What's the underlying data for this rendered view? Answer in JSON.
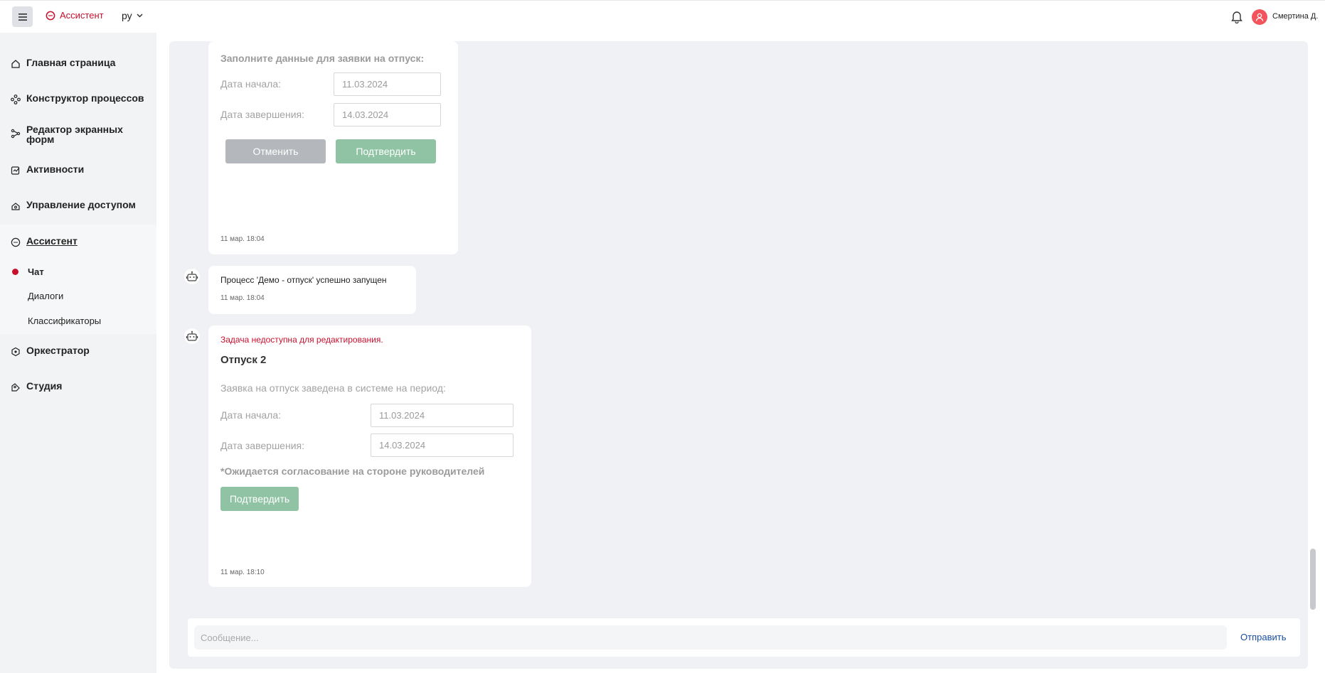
{
  "header": {
    "brand_label": "Ассистент",
    "language": "ру",
    "user_name": "Смертина Д."
  },
  "sidebar": {
    "items": [
      {
        "label": "Главная страница",
        "icon": "home-icon"
      },
      {
        "label": "Конструктор процессов",
        "icon": "process-icon"
      },
      {
        "label": "Редактор экранных форм",
        "icon": "form-editor-icon"
      },
      {
        "label": "Активности",
        "icon": "activity-icon"
      },
      {
        "label": "Управление доступом",
        "icon": "access-icon"
      },
      {
        "label": "Ассистент",
        "icon": "assistant-icon"
      },
      {
        "label": "Оркестратор",
        "icon": "orchestrator-icon"
      },
      {
        "label": "Студия",
        "icon": "studio-icon"
      }
    ],
    "assistant_sub": [
      {
        "label": "Чат",
        "active": true
      },
      {
        "label": "Диалоги"
      },
      {
        "label": "Классификаторы"
      }
    ]
  },
  "chat": {
    "form1": {
      "title": "Заполните данные для заявки на отпуск:",
      "start_label": "Дата начала:",
      "start_value": "11.03.2024",
      "end_label": "Дата завершения:",
      "end_value": "14.03.2024",
      "cancel_label": "Отменить",
      "confirm_label": "Подтвердить",
      "timestamp": "11 мар. 18:04"
    },
    "message2": {
      "text": "Процесс 'Демо - отпуск' успешно запущен",
      "timestamp": "11 мар. 18:04"
    },
    "form2": {
      "warning": "Задача недоступна для редактирования.",
      "title": "Отпуск 2",
      "subtitle": "Заявка на отпуск заведена в системе на период:",
      "start_label": "Дата начала:",
      "start_value": "11.03.2024",
      "end_label": "Дата завершения:",
      "end_value": "14.03.2024",
      "note": "*Ожидается согласование на стороне руководителей",
      "confirm_label": "Подтвердить",
      "timestamp": "11 мар. 18:10"
    }
  },
  "composer": {
    "placeholder": "Сообщение...",
    "send_label": "Отправить"
  },
  "colors": {
    "brand": "#c8102e",
    "confirm_green": "#8fc3a3",
    "cancel_grey": "#b4b7bb",
    "link_blue": "#1a4ea0"
  }
}
